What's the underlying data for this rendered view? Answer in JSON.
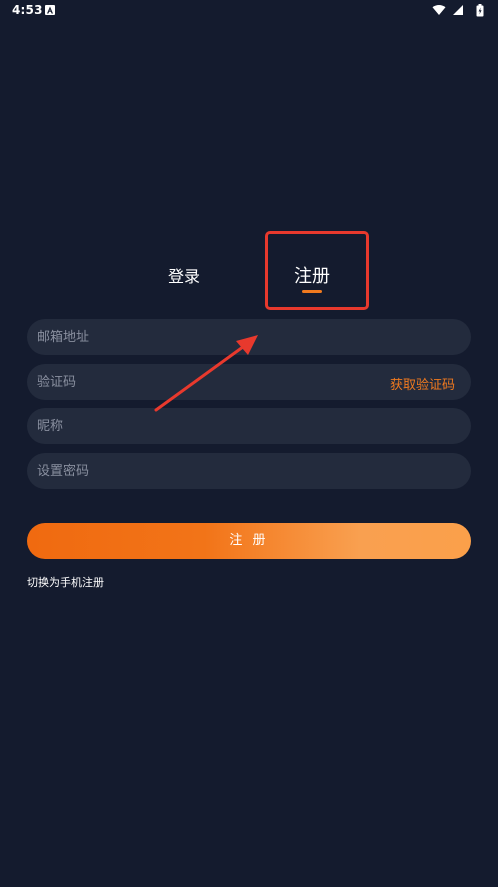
{
  "status_bar": {
    "time": "4:53",
    "icons": [
      "notification-a-icon",
      "wifi-icon",
      "signal-icon",
      "battery-icon"
    ]
  },
  "tabs": {
    "login_label": "登录",
    "register_label": "注册",
    "active": "register"
  },
  "form": {
    "email_placeholder": "邮箱地址",
    "code_placeholder": "验证码",
    "get_code_label": "获取验证码",
    "nickname_placeholder": "昵称",
    "password_placeholder": "设置密码"
  },
  "actions": {
    "register_button_label": "注 册",
    "switch_link_label": "切换为手机注册"
  },
  "colors": {
    "background": "#141b2e",
    "input_background": "#232b3d",
    "accent": "#f07a1f",
    "annotation_red": "#e8392d"
  }
}
